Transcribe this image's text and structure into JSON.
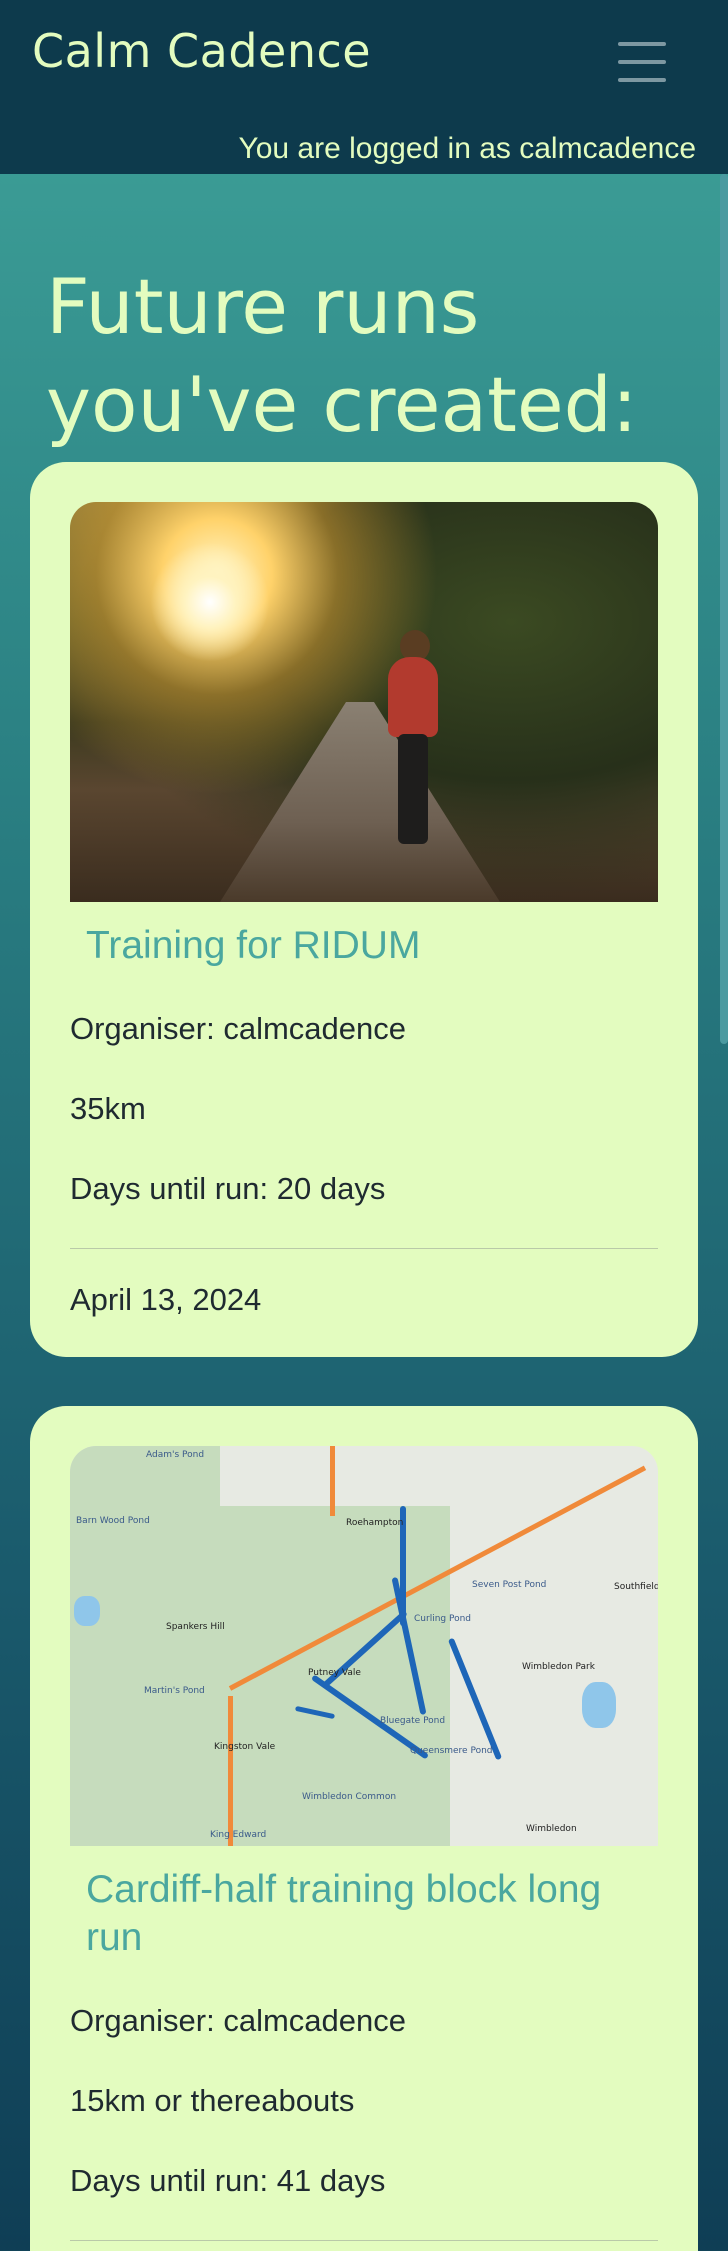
{
  "nav": {
    "brand": "Calm Cadence",
    "toggle_icon": "hamburger-menu-icon",
    "login_status": "You are logged in as calmcadence"
  },
  "page": {
    "heading": "Future runs you've created:"
  },
  "runs": [
    {
      "image": "runner-photo",
      "title": "Training for RIDUM",
      "organiser": "Organiser: calmcadence",
      "distance": "35km",
      "days_until": "Days until run: 20 days",
      "date": "April 13, 2024"
    },
    {
      "image": "route-map",
      "title": "Cardiff-half training block long run",
      "organiser": "Organiser: calmcadence",
      "distance": "15km or thereabouts",
      "days_until": "Days until run: 41 days"
    }
  ],
  "map_labels": {
    "roehampton": "Roehampton",
    "putney_vale": "Putney Vale",
    "wimbledon_park": "Wimbledon Park",
    "wimbledon_common": "Wimbledon Common",
    "wimbledon": "Wimbledon",
    "kingston_vale": "Kingston Vale",
    "southfields": "Southfields",
    "seven_post_pond": "Seven Post Pond",
    "queensmere": "Queensmere Pond",
    "bluegate_pond": "Bluegate Pond",
    "curling_pond": "Curling Pond",
    "adams_pond": "Adam's Pond",
    "barn_wood_pond": "Barn Wood Pond",
    "spankers_hill": "Spankers Hill",
    "martins_pond": "Martin's Pond",
    "king_edward": "King Edward"
  }
}
